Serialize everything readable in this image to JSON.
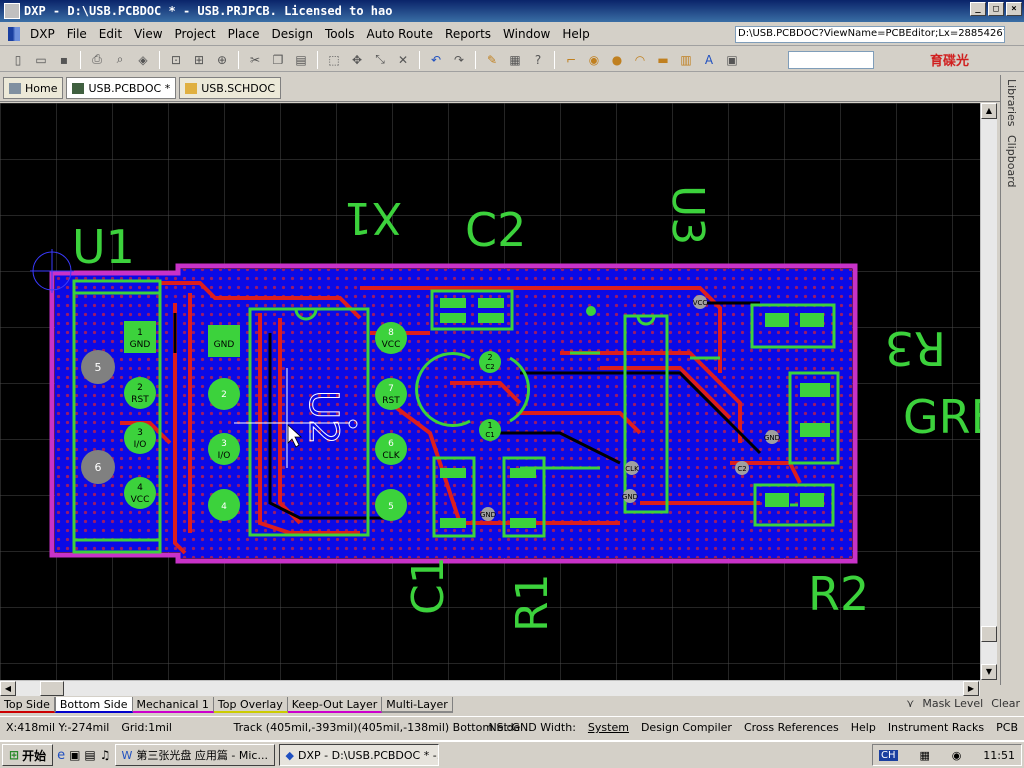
{
  "window": {
    "title": "DXP - D:\\USB.PCBDOC * - USB.PRJPCB. Licensed to hao"
  },
  "menu": {
    "logo": "DXP",
    "items": [
      "File",
      "Edit",
      "View",
      "Project",
      "Place",
      "Design",
      "Tools",
      "Auto Route",
      "Reports",
      "Window",
      "Help"
    ]
  },
  "address": {
    "value": "D:\\USB.PCBDOC?ViewName=PCBEditor;Lx=28854267"
  },
  "brand": {
    "text": "育碟光"
  },
  "tabs": [
    {
      "label": "Home"
    },
    {
      "label": "USB.PCBDOC *"
    },
    {
      "label": "USB.SCHDOC"
    }
  ],
  "side_panels": [
    "Libraries",
    "Clipboard"
  ],
  "pcb": {
    "designators": {
      "u1": "U1",
      "x1": "X1",
      "c2": "C2",
      "u3": "U3",
      "r3": "R3",
      "u2": "U2",
      "gre": "GRE",
      "c1": "C1",
      "r1": "R1",
      "r2": "R2"
    },
    "u1_pins": [
      {
        "num": "1",
        "net": "GND"
      },
      {
        "num": "2",
        "net": "RST"
      },
      {
        "num": "3",
        "net": "I/O"
      },
      {
        "num": "4",
        "net": "VCC"
      },
      {
        "num": "5",
        "net": ""
      },
      {
        "num": "6",
        "net": ""
      }
    ],
    "u2_left_pins": [
      {
        "num": "",
        "net": "GND"
      },
      {
        "num": "2",
        "net": ""
      },
      {
        "num": "3",
        "net": "I/O"
      },
      {
        "num": "4",
        "net": ""
      }
    ],
    "u2_right_pins": [
      {
        "num": "8",
        "net": "VCC"
      },
      {
        "num": "7",
        "net": "RST"
      },
      {
        "num": "6",
        "net": "CLK"
      },
      {
        "num": "5",
        "net": ""
      }
    ],
    "x1_pins": [
      {
        "num": "2",
        "net": "C2"
      },
      {
        "num": "1",
        "net": "C1"
      }
    ],
    "via_labels": {
      "vcc": "VCC",
      "gnd_r": "GND",
      "clk": "CLK",
      "gnd_u3": "GND",
      "gnd_r1": "GND",
      "c2": "C2"
    }
  },
  "layers": [
    {
      "label": "Top Side"
    },
    {
      "label": "Bottom Side"
    },
    {
      "label": "Mechanical 1"
    },
    {
      "label": "Top Overlay"
    },
    {
      "label": "Keep-Out Layer"
    },
    {
      "label": "Multi-Layer"
    }
  ],
  "layer_bar": {
    "mask_level": "Mask Level",
    "clear": "Clear"
  },
  "status": {
    "coords": "X:418mil Y:-274mil",
    "grid": "Grid:1mil",
    "track": "Track (405mil,-393mil)(405mil,-138mil)  Bottom Side",
    "net": "Net:GND Width:",
    "panels": [
      "System",
      "Design Compiler",
      "Cross References",
      "Help",
      "Instrument Racks",
      "PCB"
    ]
  },
  "taskbar": {
    "start": "开始",
    "tasks": [
      "第三张光盘 应用篇 - Mic...",
      "DXP - D:\\USB.PCBDOC * -..."
    ],
    "ime": "CH",
    "clock": "11:51"
  },
  "colors": {
    "board_fill": "#0a0ae6",
    "outline": "#c832c8",
    "overlay": "#3cd23c",
    "track": "#dc1e1e",
    "pad": "#3cd23c",
    "grid": "#4a4a4a"
  }
}
